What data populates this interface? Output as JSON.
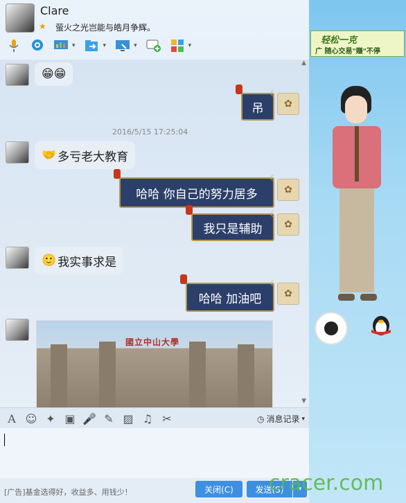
{
  "header": {
    "nickname": "Clare",
    "signature": "萤火之光岂能与皓月争辉。",
    "toolbar_icons": [
      "microphone-icon",
      "camera-icon",
      "screen-share-icon",
      "file-transfer-icon",
      "remote-desktop-icon",
      "add-chat-icon",
      "apps-icon"
    ]
  },
  "chat": {
    "timestamp": "2016/5/15 17:25:04",
    "messages": [
      {
        "side": "left",
        "text": "😁😁"
      },
      {
        "side": "right",
        "text": "吊"
      },
      {
        "side": "left",
        "text": "多亏老大教育"
      },
      {
        "side": "right",
        "text": "哈哈 你自己的努力居多"
      },
      {
        "side": "right",
        "text": "我只是辅助"
      },
      {
        "side": "left",
        "text": "我实事求是"
      },
      {
        "side": "right",
        "text": "哈哈 加油吧"
      }
    ],
    "photo_caption": "國立中山大學"
  },
  "input_toolbar": {
    "history_label": "消息记录"
  },
  "footer": {
    "ad_text": "[广告]基金选得好，收益多、用钱少！",
    "close_label": "关闭(C)",
    "send_label": "发送(S)"
  },
  "right_panel": {
    "banner_line1": "轻松一克",
    "banner_line2": "广 随心交易\"赚\"不停"
  },
  "watermark": "cracer.com",
  "colors": {
    "accent": "#3e8fe0",
    "bubble_right": "#2c3f6a",
    "bubble_left": "#e8eef5"
  }
}
